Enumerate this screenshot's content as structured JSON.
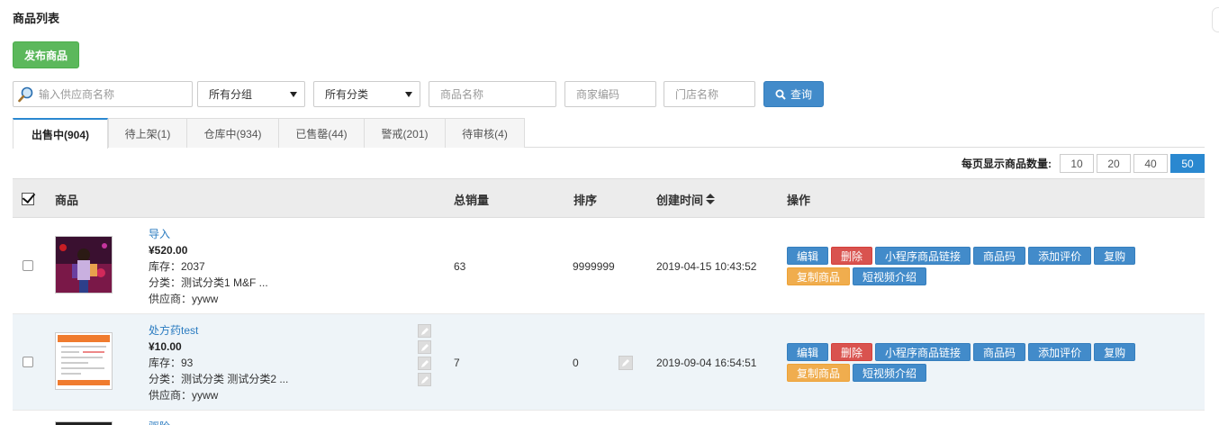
{
  "page": {
    "title": "商品列表"
  },
  "toolbar": {
    "publish_label": "发布商品"
  },
  "filters": {
    "supplier_placeholder": "输入供应商名称",
    "group_select": "所有分组",
    "category_select": "所有分类",
    "name_placeholder": "商品名称",
    "code_placeholder": "商家编码",
    "store_placeholder": "门店名称",
    "query_label": "查询"
  },
  "tabs": [
    {
      "label": "出售中(904)",
      "active": true
    },
    {
      "label": "待上架(1)"
    },
    {
      "label": "仓库中(934)"
    },
    {
      "label": "已售罄(44)"
    },
    {
      "label": "警戒(201)"
    },
    {
      "label": "待审核(4)"
    }
  ],
  "pager": {
    "label": "每页显示商品数量:",
    "options": [
      "10",
      "20",
      "40",
      "50"
    ],
    "active": "50"
  },
  "table": {
    "headers": {
      "product": "商品",
      "sales": "总销量",
      "sort": "排序",
      "created": "创建时间",
      "ops": "操作"
    },
    "rows": [
      {
        "name": "导入",
        "price": "¥520.00",
        "stock": "库存：2037",
        "category": "分类：测试分类1 M&F ...",
        "supplier": "供应商：yyww",
        "sales": "63",
        "sort": "9999999",
        "created": "2019-04-15 10:43:52"
      },
      {
        "name": "处方药test",
        "price": "¥10.00",
        "stock": "库存：93",
        "category": "分类：测试分类 测试分类2 ...",
        "supplier": "供应商：yyww",
        "sales": "7",
        "sort": "0",
        "created": "2019-09-04 16:54:51"
      }
    ],
    "partial_row_name": "驱险"
  },
  "ops": {
    "edit": "编辑",
    "delete": "删除",
    "mini_link": "小程序商品链接",
    "qr": "商品码",
    "add_review": "添加评价",
    "rebuy": "复购",
    "copy": "复制商品",
    "video": "短视频介绍"
  },
  "colors": {
    "green": "#5cb85c",
    "blue": "#428bca",
    "red": "#d9534f",
    "orange": "#f0ad4e",
    "tab_accent": "#2a88d0"
  },
  "icons": [
    "magnifier-icon",
    "caret-down-icon",
    "search-icon",
    "checkbox-checked-icon",
    "sort-icon",
    "pencil-icon"
  ]
}
